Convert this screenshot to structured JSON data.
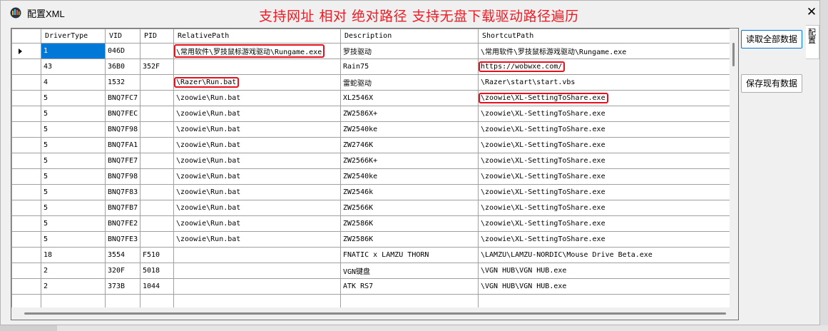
{
  "window": {
    "title": "配置XML",
    "banner": "支持网址 相对 绝对路径 支持无盘下载驱动路径遍历",
    "close_glyph": "✕"
  },
  "side_tab": {
    "label": "配置"
  },
  "buttons": {
    "read_all": "读取全部数据",
    "save_current": "保存现有数据"
  },
  "grid": {
    "columns": [
      "DriverType",
      "VID",
      "PID",
      "RelativePath",
      "Description",
      "ShortcutPath"
    ],
    "rows": [
      {
        "DriverType": "1",
        "VID": "046D",
        "PID": "",
        "RelativePath": "\\常用软件\\罗技鼠标游戏驱动\\Rungame.exe",
        "Description": "罗技驱动",
        "ShortcutPath": "\\常用软件\\罗技鼠标游戏驱动\\Rungame.exe"
      },
      {
        "DriverType": "43",
        "VID": "36B0",
        "PID": "352F",
        "RelativePath": "",
        "Description": "Rain75",
        "ShortcutPath": "https://wobwxe.com/"
      },
      {
        "DriverType": "4",
        "VID": "1532",
        "PID": "",
        "RelativePath": "\\Razer\\Run.bat",
        "Description": "雷蛇驱动",
        "ShortcutPath": "\\Razer\\start\\start.vbs"
      },
      {
        "DriverType": "5",
        "VID": "BNQ7FC7",
        "PID": "",
        "RelativePath": "\\zoowie\\Run.bat",
        "Description": "XL2546X",
        "ShortcutPath": "\\zoowie\\XL-SettingToShare.exe"
      },
      {
        "DriverType": "5",
        "VID": "BNQ7FEC",
        "PID": "",
        "RelativePath": "\\zoowie\\Run.bat",
        "Description": "ZW2586X+",
        "ShortcutPath": "\\zoowie\\XL-SettingToShare.exe"
      },
      {
        "DriverType": "5",
        "VID": "BNQ7F98",
        "PID": "",
        "RelativePath": "\\zoowie\\Run.bat",
        "Description": "ZW2540ke",
        "ShortcutPath": "\\zoowie\\XL-SettingToShare.exe"
      },
      {
        "DriverType": "5",
        "VID": "BNQ7FA1",
        "PID": "",
        "RelativePath": "\\zoowie\\Run.bat",
        "Description": "ZW2746K",
        "ShortcutPath": "\\zoowie\\XL-SettingToShare.exe"
      },
      {
        "DriverType": "5",
        "VID": "BNQ7FE7",
        "PID": "",
        "RelativePath": "\\zoowie\\Run.bat",
        "Description": "ZW2566K+",
        "ShortcutPath": "\\zoowie\\XL-SettingToShare.exe"
      },
      {
        "DriverType": "5",
        "VID": "BNQ7F98",
        "PID": "",
        "RelativePath": "\\zoowie\\Run.bat",
        "Description": "ZW2540ke",
        "ShortcutPath": "\\zoowie\\XL-SettingToShare.exe"
      },
      {
        "DriverType": "5",
        "VID": "BNQ7F83",
        "PID": "",
        "RelativePath": "\\zoowie\\Run.bat",
        "Description": "ZW2546k",
        "ShortcutPath": "\\zoowie\\XL-SettingToShare.exe"
      },
      {
        "DriverType": "5",
        "VID": "BNQ7FB7",
        "PID": "",
        "RelativePath": "\\zoowie\\Run.bat",
        "Description": "ZW2566K",
        "ShortcutPath": "\\zoowie\\XL-SettingToShare.exe"
      },
      {
        "DriverType": "5",
        "VID": "BNQ7FE2",
        "PID": "",
        "RelativePath": "\\zoowie\\Run.bat",
        "Description": "ZW2586K",
        "ShortcutPath": "\\zoowie\\XL-SettingToShare.exe"
      },
      {
        "DriverType": "5",
        "VID": "BNQ7FE3",
        "PID": "",
        "RelativePath": "\\zoowie\\Run.bat",
        "Description": "ZW2586K",
        "ShortcutPath": "\\zoowie\\XL-SettingToShare.exe"
      },
      {
        "DriverType": "18",
        "VID": "3554",
        "PID": "F510",
        "RelativePath": "",
        "Description": "FNATIC x LAMZU THORN",
        "ShortcutPath": "\\LAMZU\\LAMZU-NORDIC\\Mouse Drive Beta.exe"
      },
      {
        "DriverType": "2",
        "VID": "320F",
        "PID": "5018",
        "RelativePath": "",
        "Description": "VGN键盘",
        "ShortcutPath": "\\VGN HUB\\VGN HUB.exe"
      },
      {
        "DriverType": "2",
        "VID": "373B",
        "PID": "1044",
        "RelativePath": "",
        "Description": "ATK RS7",
        "ShortcutPath": "\\VGN HUB\\VGN HUB.exe"
      },
      {
        "DriverType": "",
        "VID": "",
        "PID": "",
        "RelativePath": "",
        "Description": "",
        "ShortcutPath": ""
      }
    ]
  },
  "colors": {
    "banner": "#ee1c25",
    "selection": "#0078d7",
    "highlight_box": "#e8101b"
  }
}
